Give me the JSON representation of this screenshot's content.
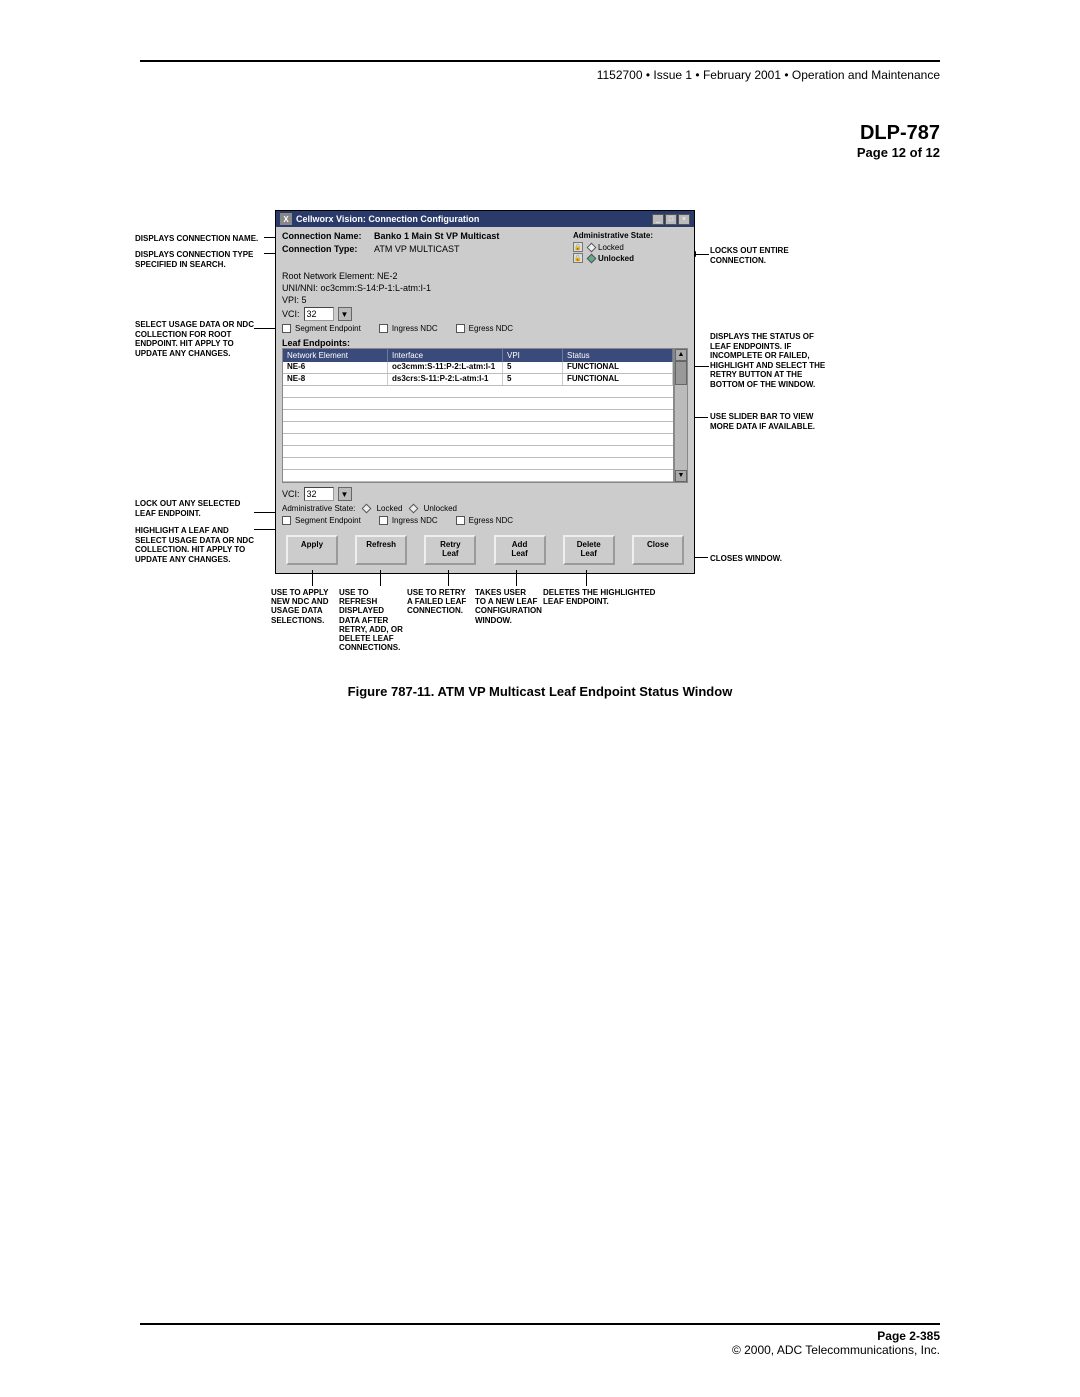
{
  "header": {
    "doc_id": "1152700",
    "issue": "Issue 1",
    "date": "February 2001",
    "section": "Operation and Maintenance"
  },
  "title": "DLP-787",
  "page_of": "Page 12 of 12",
  "window": {
    "title": "Cellworx Vision: Connection Configuration",
    "conn_name_label": "Connection Name:",
    "conn_name_value": "Banko 1 Main St VP Multicast",
    "conn_type_label": "Connection Type:",
    "conn_type_value": "ATM VP MULTICAST",
    "admin_state_label": "Administrative State:",
    "locked": "Locked",
    "unlocked": "Unlocked",
    "root_ne": "Root Network Element:  NE-2",
    "uni_nni": "UNI/NNI:  oc3cmm:S-14:P-1:L-atm:I-1",
    "vpi": "VPI:  5",
    "vci_label": "VCI:",
    "vci_value": "32",
    "segment_endpoint": "Segment Endpoint",
    "ingress_ndc": "Ingress NDC",
    "egress_ndc": "Egress NDC",
    "leaf_endpoints_label": "Leaf Endpoints:",
    "table": {
      "headers": [
        "Network Element",
        "Interface",
        "VPI",
        "Status"
      ],
      "rows": [
        {
          "ne": "NE-6",
          "iface": "oc3cmm:S-11:P-2:L-atm:I-1",
          "vpi": "5",
          "status": "FUNCTIONAL"
        },
        {
          "ne": "NE-8",
          "iface": "ds3crs:S-11:P-2:L-atm:I-1",
          "vpi": "5",
          "status": "FUNCTIONAL"
        }
      ]
    },
    "vci2_label": "VCI:",
    "vci2_value": "32",
    "adm_state2": "Administrative State:",
    "buttons": {
      "apply": "Apply",
      "refresh": "Refresh",
      "retry": "Retry\nLeaf",
      "add": "Add\nLeaf",
      "delete": "Delete\nLeaf",
      "close": "Close"
    }
  },
  "callouts": {
    "conn_name": "DISPLAYS CONNECTION NAME.",
    "conn_type": "DISPLAYS CONNECTION TYPE SPECIFIED IN SEARCH.",
    "usage_data": "SELECT USAGE DATA OR NDC COLLECTION FOR ROOT ENDPOINT. HIT APPLY TO UPDATE ANY CHANGES.",
    "lock_selected": "LOCK OUT ANY SELECTED LEAF ENDPOINT.",
    "highlight_leaf": "HIGHLIGHT A LEAF AND SELECT USAGE DATA OR NDC COLLECTION. HIT APPLY TO UPDATE ANY CHANGES.",
    "locks_out": "LOCKS OUT ENTIRE CONNECTION.",
    "status_desc": "DISPLAYS THE STATUS OF LEAF ENDPOINTS. IF INCOMPLETE OR FAILED, HIGHLIGHT AND SELECT THE RETRY BUTTON AT THE BOTTOM OF THE WINDOW.",
    "slider": "USE SLIDER BAR TO VIEW MORE DATA IF AVAILABLE.",
    "closes": "CLOSES WINDOW."
  },
  "button_callouts": {
    "apply": "USE TO APPLY NEW NDC AND USAGE DATA SELECTIONS.",
    "refresh": "USE TO REFRESH DISPLAYED DATA AFTER RETRY, ADD, OR DELETE LEAF CONNECTIONS.",
    "retry": "USE TO RETRY A FAILED LEAF CONNECTION.",
    "add": "TAKES USER TO A NEW LEAF CONFIGURATION WINDOW.",
    "delete": "DELETES THE HIGHLIGHTED LEAF ENDPOINT."
  },
  "figure_caption": "Figure 787-11. ATM VP Multicast Leaf Endpoint Status Window",
  "footer": {
    "page": "Page 2-385",
    "copyright": "© 2000, ADC Telecommunications, Inc."
  }
}
